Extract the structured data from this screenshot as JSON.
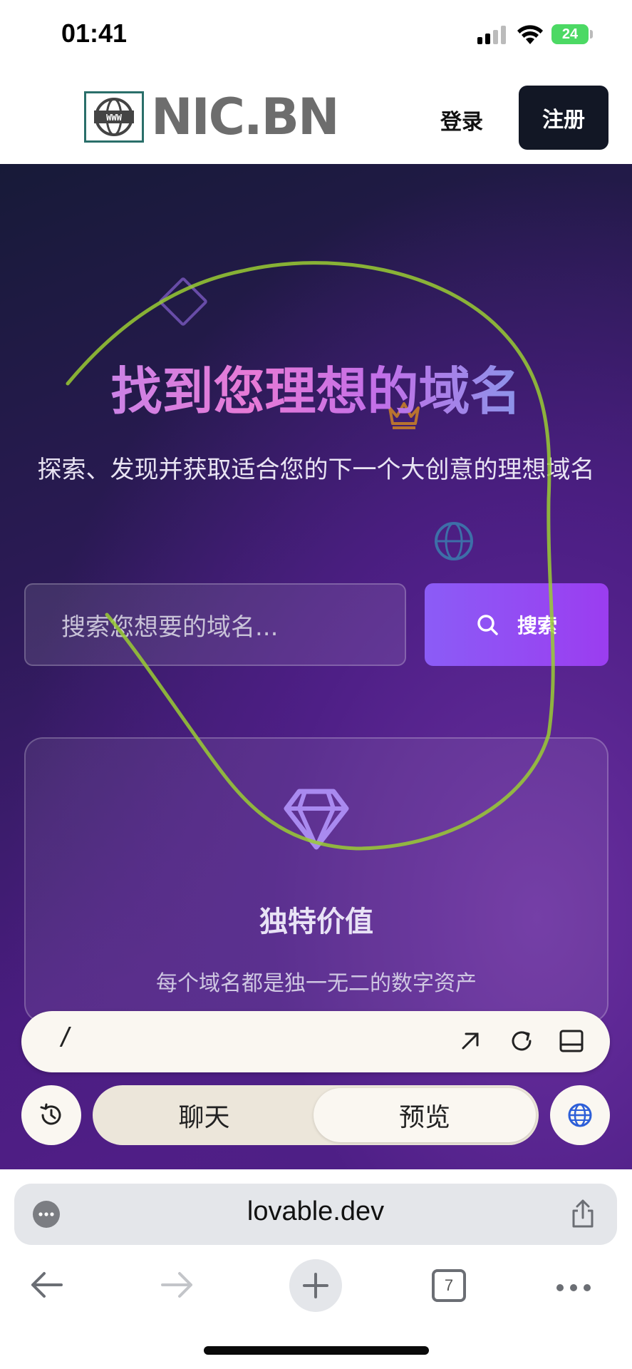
{
  "status_bar": {
    "time": "01:41",
    "battery": "24"
  },
  "site": {
    "logo_text": "NIC.BN",
    "login": "登录",
    "register": "注册"
  },
  "hero": {
    "title": "找到您理想的域名",
    "subtitle": "探索、发现并获取适合您的下一个大创意的理想域名",
    "search_placeholder": "搜索您想要的域名...",
    "search_button": "搜索"
  },
  "feature": {
    "title": "独特价值",
    "description": "每个域名都是独一无二的数字资产"
  },
  "editor_bar": {
    "path": "/",
    "tab_chat": "聊天",
    "tab_preview": "预览",
    "active_tab": "预览"
  },
  "browser": {
    "url": "lovable.dev",
    "tab_count": "7"
  },
  "colors": {
    "register_bg": "#121725",
    "search_button": "#8b5cf6",
    "battery": "#4cd964",
    "scribble": "#9acd32"
  }
}
